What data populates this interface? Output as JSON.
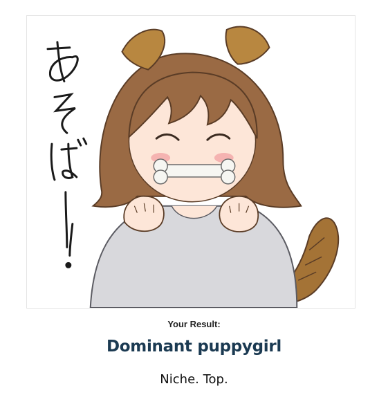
{
  "quiz_result": {
    "label": "Your Result:",
    "title": "Dominant puppygirl",
    "description": "Niche. Top.",
    "image": {
      "caption_text": "あそぼー!",
      "subject": "anime dog-eared girl holding a bone in her mouth",
      "colors": {
        "hair": "#9a6a44",
        "ears": "#b88740",
        "sweater": "#d8d8dc",
        "skin": "#fde6d8",
        "blush": "#f3a6a8",
        "tail": "#a47336",
        "outline": "#5a3c26"
      }
    }
  }
}
